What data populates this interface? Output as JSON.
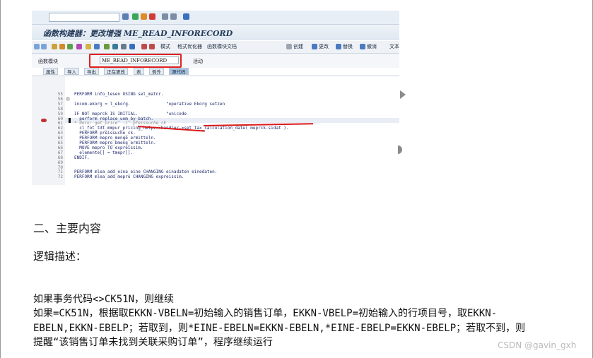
{
  "sap": {
    "window_title": "函数构建器：更改增强 ME_READ_INFORECORD",
    "toolbar": [
      "模式",
      "格式优化器",
      "函数模块文档",
      "创建",
      "更改",
      "替换",
      "撤消",
      "文本"
    ],
    "function_module_label": "函数模块",
    "function_module_value": "ME_READ_INFORECORD",
    "status": "活动",
    "tabs": [
      "属性",
      "导入",
      "导出",
      "正在更改",
      "表",
      "例外",
      "源代码"
    ],
    "active_tab": "源代码",
    "code_lines": [
      {
        "num": "55",
        "text": "PERFORM info_lesen USING sel_matnr.",
        "style": "code"
      },
      {
        "num": "56",
        "text": "",
        "style": "code"
      },
      {
        "num": "57",
        "text": "incom-ekorg = l_ekorg.              \"operative Ekorg setzen",
        "style": "code"
      },
      {
        "num": "58",
        "text": "",
        "style": "code"
      },
      {
        "num": "59",
        "text": "IF NOT meprck IS INITIAL.           \"unicode",
        "style": "code"
      },
      {
        "num": "60",
        "text": "  perform replace_uom_by_batch.",
        "style": "code"
      },
      {
        "num": "61",
        "text": "* docu: get price  -)  preissuche_ck",
        "style": "cm"
      },
      {
        "num": "62",
        "text": "  cl_fot_tdt_mmpur_pricing_helpr=>handler->set_tax_calculation_date( meprck-sidat ).",
        "style": "code"
      },
      {
        "num": "63",
        "text": "  PERFORM preissuche_ck.",
        "style": "code"
      },
      {
        "num": "64",
        "text": "  PERFORM mepro_menge_ermitteln.",
        "style": "code"
      },
      {
        "num": "65",
        "text": "  PERFORM mepro_bmeng_ermitteln.",
        "style": "code"
      },
      {
        "num": "66",
        "text": "  MOVE mepro TO expreissim.",
        "style": "code"
      },
      {
        "num": "67",
        "text": "  elemente[] = tmepr[].",
        "style": "code"
      },
      {
        "num": "68",
        "text": "ENDIF.",
        "style": "code"
      },
      {
        "num": "69",
        "text": "",
        "style": "code"
      },
      {
        "num": "70",
        "text": "",
        "style": "code"
      },
      {
        "num": "71",
        "text": "PERFORM mlea_add_eina_eine CHANGING einadaten einedaten.",
        "style": "code"
      },
      {
        "num": "72",
        "text": "PERFORM mlea_add_mepro CHANGING expreissim.",
        "style": "code"
      }
    ]
  },
  "content": {
    "section_heading": "二、主要内容",
    "logic_label": "逻辑描述：",
    "para_line1": "如果事务代码<>CK51N，则继续",
    "para_line2": "如果=CK51N，根据取EKKN-VBELN=初始输入的销售订单，EKKN-VBELP=初始输入的行项目号，取EKKN-",
    "para_line3": "EBELN,EKKN-EBELP；若取到，则*EINE-EBELN=EKKN-EBELN,*EINE-EBELP=EKKN-EBELP；若取不到，则",
    "para_line4": "提醒“该销售订单未找到关联采购订单”，程序继续运行"
  },
  "watermark": "CSDN @gavin_gxh"
}
